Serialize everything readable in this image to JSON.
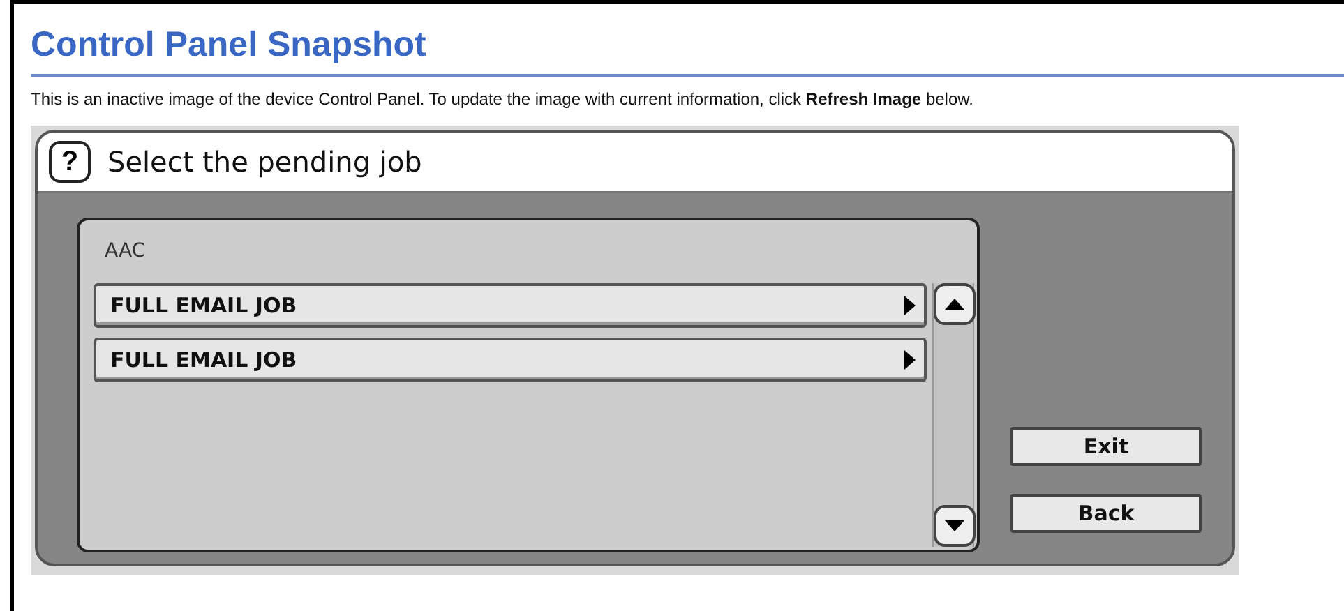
{
  "page": {
    "title": "Control Panel Snapshot",
    "description": "This is an inactive image of the device Control Panel. To update the image with current information, click **Refresh Image** below."
  },
  "panel": {
    "help": "?",
    "prompt": "Select the pending job",
    "list_title": "AAC",
    "jobs": [
      {
        "label": "FULL EMAIL JOB"
      },
      {
        "label": "FULL EMAIL JOB"
      }
    ],
    "buttons": [
      {
        "label": "Exit"
      },
      {
        "label": "Back"
      }
    ]
  }
}
